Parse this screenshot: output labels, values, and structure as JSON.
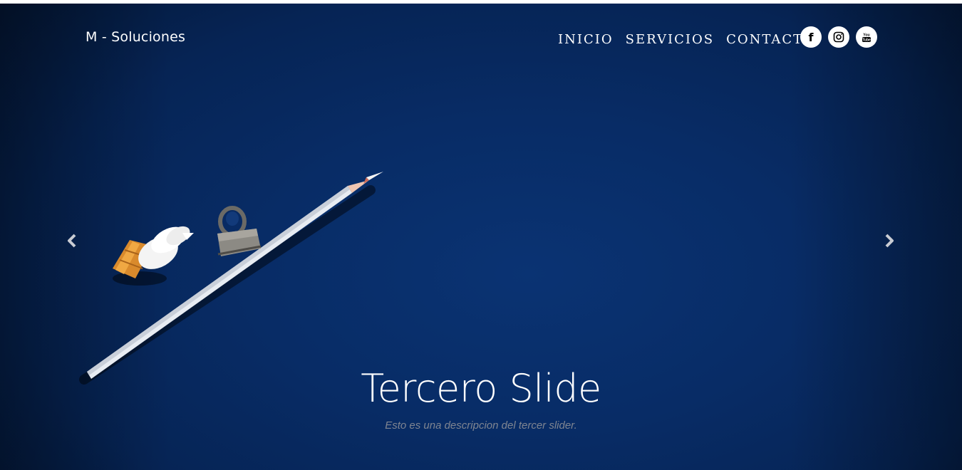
{
  "header": {
    "brand": "M - Soluciones",
    "nav": [
      {
        "label": "INICIO"
      },
      {
        "label": "SERVICIOS"
      },
      {
        "label": "CONTACTO"
      }
    ],
    "socials": [
      {
        "icon": "facebook-icon",
        "glyph": "f"
      },
      {
        "icon": "instagram-icon"
      },
      {
        "icon": "youtube-icon"
      }
    ]
  },
  "slide": {
    "title": "Tercero Slide",
    "description": "Esto es una descripcion del tercer slider."
  },
  "colors": {
    "background": "#082c66",
    "text": "#ffffff",
    "description": "#7f8591"
  }
}
